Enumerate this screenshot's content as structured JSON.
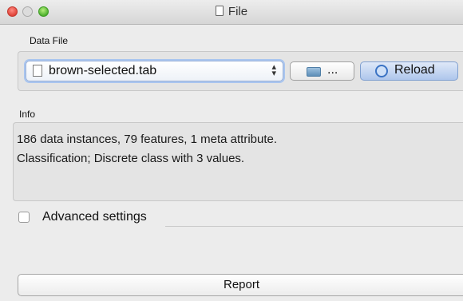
{
  "window": {
    "title": "File"
  },
  "data_file": {
    "group_label": "Data File",
    "selected_file": "brown-selected.tab",
    "browse_label": "...",
    "reload_label": "Reload"
  },
  "info": {
    "group_label": "Info",
    "line1": "186 data instances, 79 features, 1 meta attribute.",
    "line2": "Classification; Discrete class with 3 values."
  },
  "advanced": {
    "label": "Advanced settings",
    "checked": false
  },
  "report": {
    "label": "Report"
  },
  "icons": {
    "close": "close-icon",
    "minimize": "minimize-icon",
    "zoom": "zoom-icon",
    "title_doc": "document-icon",
    "file_doc": "document-icon",
    "combo_arrows": "updown-arrows-icon",
    "folder": "folder-icon",
    "reload": "reload-icon"
  },
  "colors": {
    "close": "#e0443a",
    "zoom": "#4fb12f",
    "reload_button": "#aec6ec",
    "focus_ring": "#a9c5ef"
  }
}
